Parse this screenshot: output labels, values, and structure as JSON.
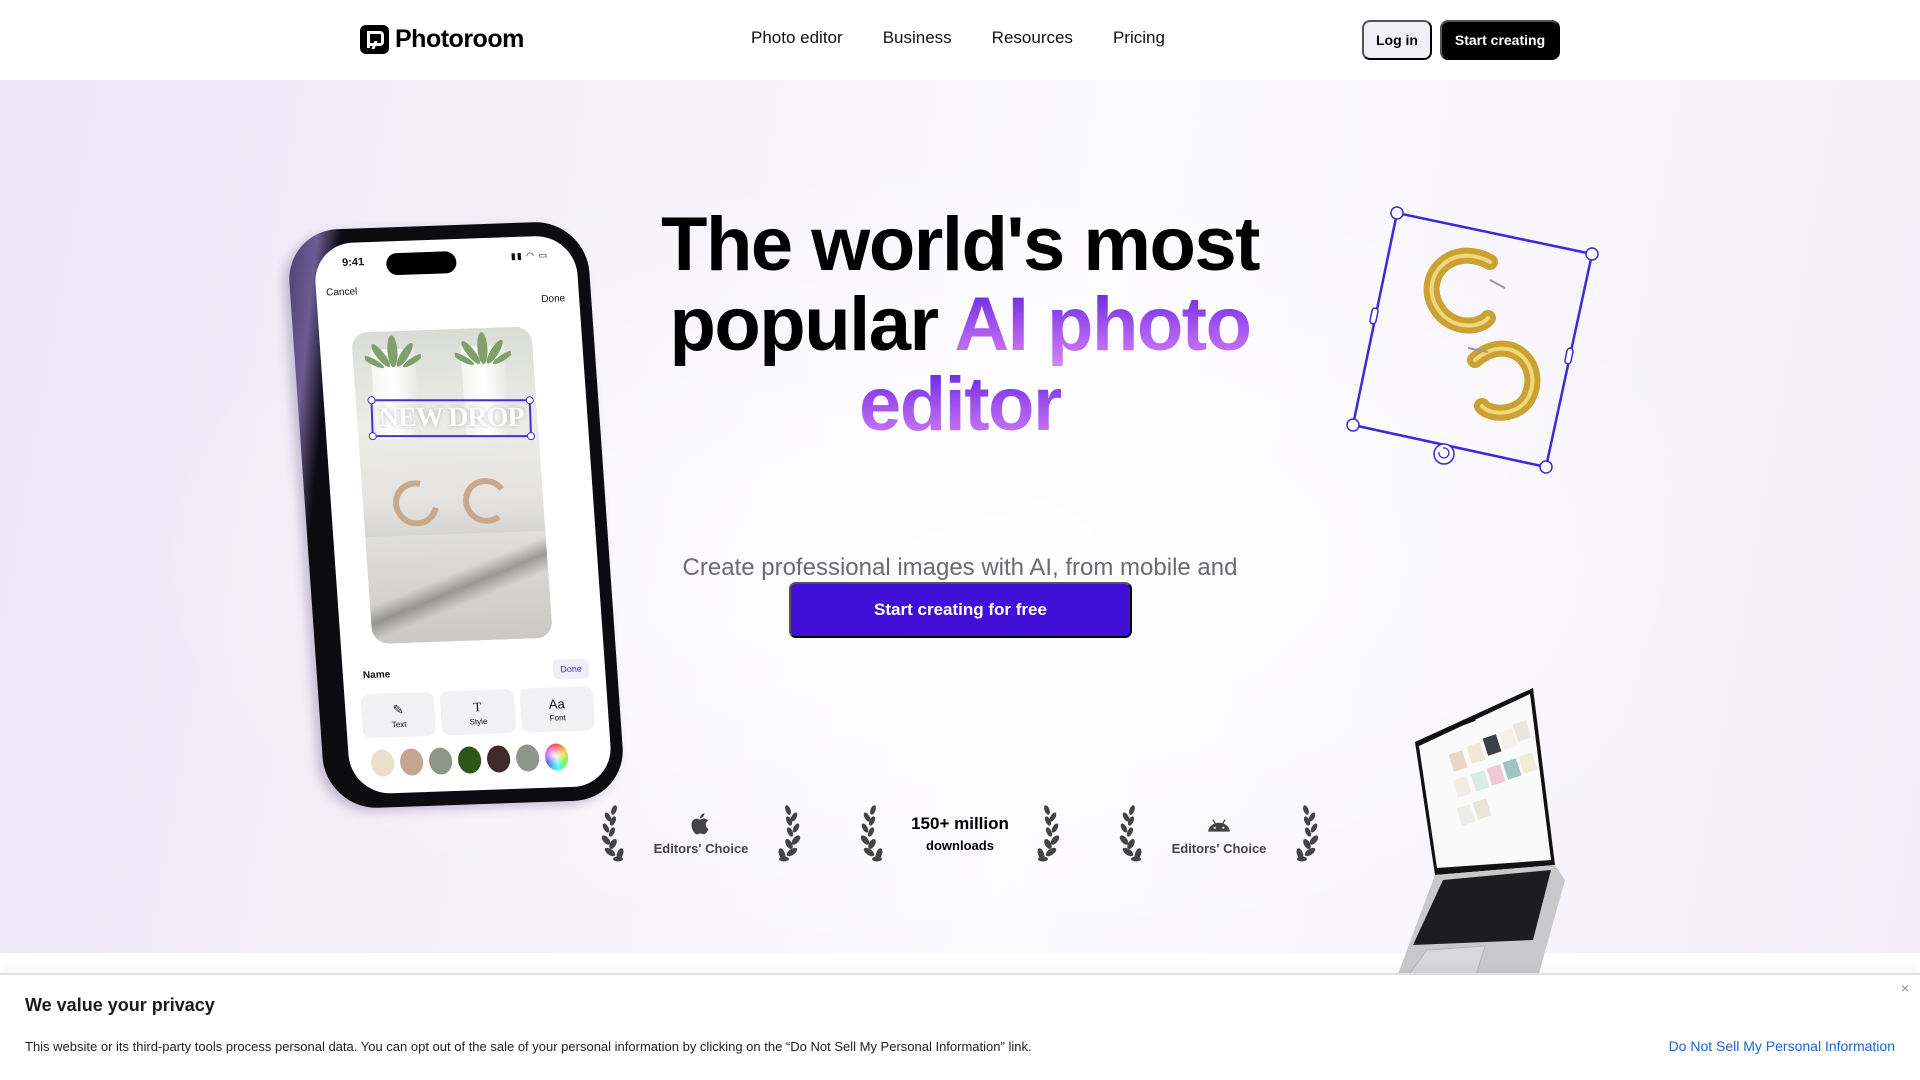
{
  "nav": {
    "brand": "Photoroom",
    "links": [
      "Photo editor",
      "Business",
      "Resources",
      "Pricing"
    ],
    "login_label": "Log in",
    "start_label": "Start creating"
  },
  "hero": {
    "headline_line1": "The world's most",
    "headline_line2_plain": "popular ",
    "headline_line2_accent": "AI photo",
    "headline_line3_accent": "editor",
    "subtitle": "Create professional images with AI, from mobile and desktop",
    "cta_label": "Start creating for free",
    "accent_color": "#4110d8"
  },
  "badges": [
    {
      "icon": "apple-icon",
      "label": "Editors' Choice"
    },
    {
      "big": "150+ million",
      "small": "downloads"
    },
    {
      "icon": "android-icon",
      "label": "Editors' Choice"
    }
  ],
  "phone": {
    "time": "9:41",
    "cancel": "Cancel",
    "done": "Done",
    "overlay_text": "NEW DROP",
    "panel_label": "Name",
    "panel_done": "Done",
    "tools": [
      {
        "icon": "pencil-icon",
        "glyph": "✎",
        "label": "Text"
      },
      {
        "icon": "text-style-icon",
        "glyph": "T",
        "label": "Style"
      },
      {
        "icon": "font-icon",
        "glyph": "Aa",
        "label": "Font"
      }
    ],
    "swatches": [
      "#e8e0c8",
      "#c4a592",
      "#8e968a",
      "#2f5418",
      "#3e2a28",
      "#8e968c",
      "rainbow"
    ]
  },
  "privacy": {
    "title": "We value your privacy",
    "text": "This website or its third-party tools process personal data. You can opt out of the sale of your personal information by clicking on the “Do Not Sell My Personal Information” link.",
    "link_label": "Do Not Sell My Personal Information",
    "close_glyph": "×",
    "link_color": "#1c63d1"
  }
}
